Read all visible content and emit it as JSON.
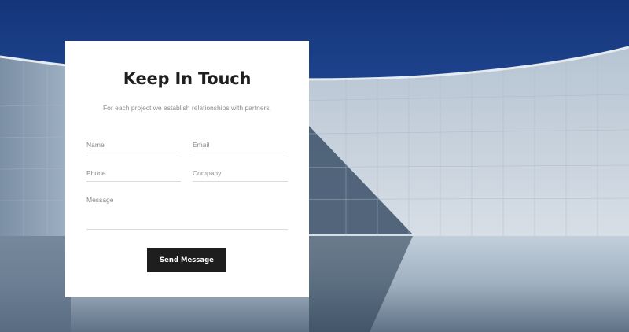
{
  "contact": {
    "title": "Keep In Touch",
    "subtitle": "For each project we establish relationships with partners.",
    "fields": {
      "name_placeholder": "Name",
      "email_placeholder": "Email",
      "phone_placeholder": "Phone",
      "company_placeholder": "Company",
      "message_placeholder": "Message"
    },
    "submit_label": "Send Message"
  },
  "colors": {
    "sky_top": "#1c3f86",
    "card_background": "#ffffff",
    "button_background": "#1e1e1e",
    "button_text": "#ffffff",
    "title_text": "#1f1f1f",
    "muted_text": "#8e8e8e"
  }
}
